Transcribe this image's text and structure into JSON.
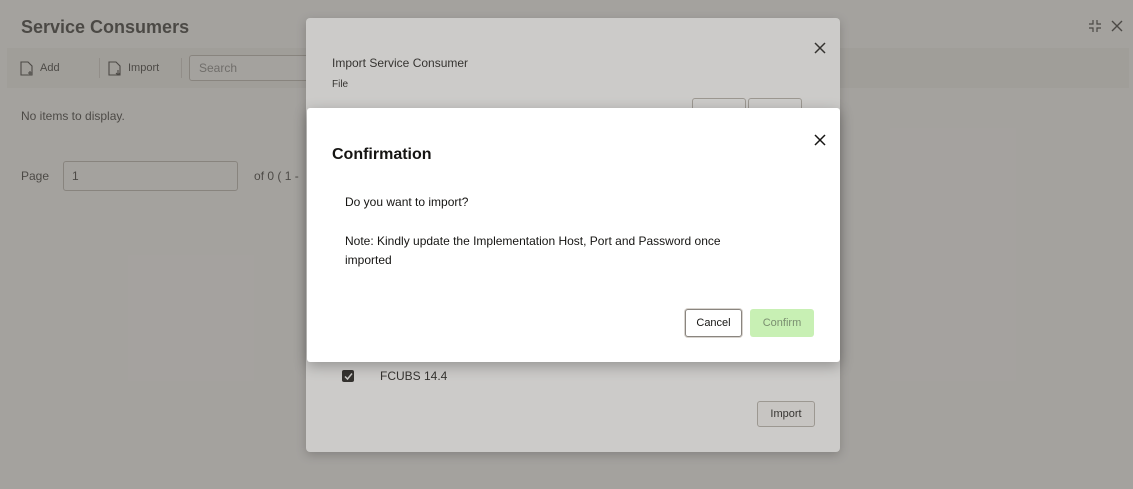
{
  "page": {
    "title": "Service Consumers",
    "toolbar": {
      "add_label": "Add",
      "import_label": "Import",
      "search_placeholder": "Search"
    },
    "empty_message": "No items to display.",
    "pager": {
      "label": "Page",
      "value": "1",
      "info": "of 0   ( 1 -"
    },
    "window_icons": [
      "collapse-icon",
      "close-icon"
    ]
  },
  "import_dialog": {
    "title": "Import Service Consumer",
    "file_label": "File",
    "consumer_item": "FCUBS 14.4",
    "consumer_checked": true,
    "import_button": "Import"
  },
  "confirm_dialog": {
    "title": "Confirmation",
    "question": "Do you want to import?",
    "note": "Note: Kindly update the Implementation Host, Port and Password once imported",
    "cancel_label": "Cancel",
    "confirm_label": "Confirm",
    "confirm_color": "#c8f0b4"
  }
}
